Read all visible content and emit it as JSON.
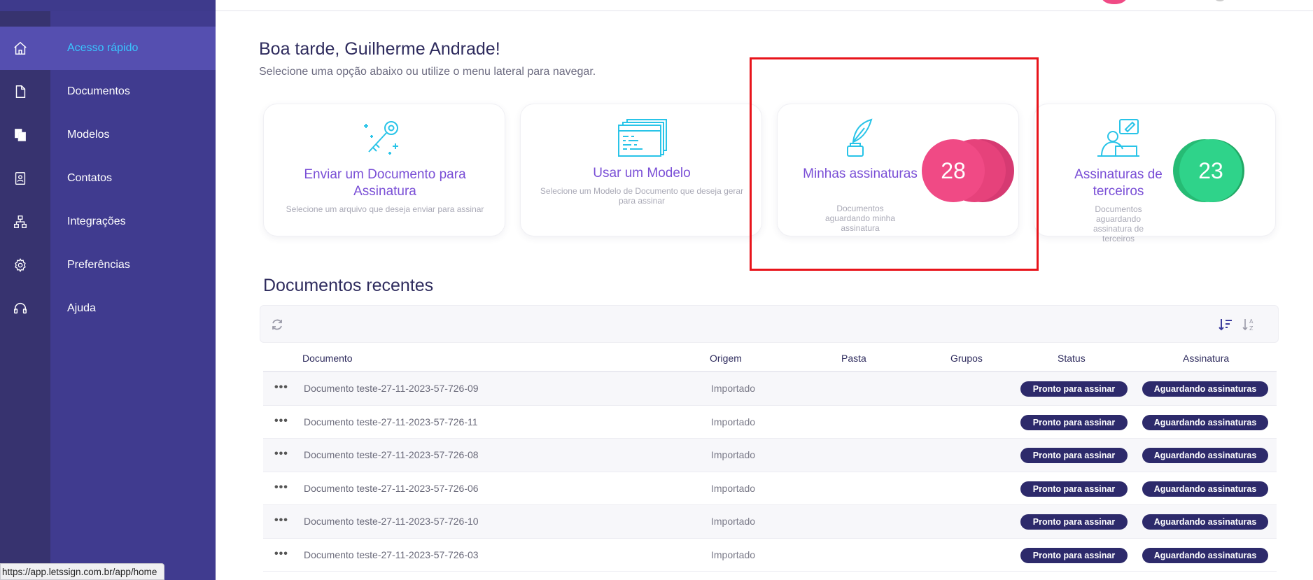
{
  "sidebar": {
    "items": [
      {
        "label": "Acesso rápido",
        "icon": "home-icon"
      },
      {
        "label": "Documentos",
        "icon": "document-icon"
      },
      {
        "label": "Modelos",
        "icon": "templates-icon"
      },
      {
        "label": "Contatos",
        "icon": "contacts-icon"
      },
      {
        "label": "Integrações",
        "icon": "integrations-icon"
      },
      {
        "label": "Preferências",
        "icon": "gear-icon"
      },
      {
        "label": "Ajuda",
        "icon": "headset-icon"
      }
    ],
    "active_index": 0
  },
  "header": {
    "greeting": "Boa tarde, Guilherme Andrade!",
    "subtitle": "Selecione uma opção abaixo ou utilize o menu lateral para navegar."
  },
  "cards": [
    {
      "title": "Enviar um Documento para Assinatura",
      "description": "Selecione um arquivo que deseja enviar para assinar",
      "icon": "key-icon"
    },
    {
      "title": "Usar um Modelo",
      "description": "Selecione um Modelo de Documento que deseja gerar para assinar",
      "icon": "template-stack-icon"
    },
    {
      "title": "Minhas assinaturas",
      "description": "Documentos aguardando minha assinatura",
      "icon": "quill-icon",
      "count": "28"
    },
    {
      "title": "Assinaturas de terceiros",
      "description": "Documentos aguardando assinatura de terceiros",
      "icon": "person-signing-icon",
      "count": "23"
    }
  ],
  "recent": {
    "title": "Documentos recentes",
    "columns": [
      "Documento",
      "Origem",
      "Pasta",
      "Grupos",
      "Status",
      "Assinatura"
    ],
    "rows": [
      {
        "document": "Documento teste-27-11-2023-57-726-09",
        "origin": "Importado",
        "status": "Pronto para assinar",
        "signature": "Aguardando assinaturas"
      },
      {
        "document": "Documento teste-27-11-2023-57-726-11",
        "origin": "Importado",
        "status": "Pronto para assinar",
        "signature": "Aguardando assinaturas"
      },
      {
        "document": "Documento teste-27-11-2023-57-726-08",
        "origin": "Importado",
        "status": "Pronto para assinar",
        "signature": "Aguardando assinaturas"
      },
      {
        "document": "Documento teste-27-11-2023-57-726-06",
        "origin": "Importado",
        "status": "Pronto para assinar",
        "signature": "Aguardando assinaturas"
      },
      {
        "document": "Documento teste-27-11-2023-57-726-10",
        "origin": "Importado",
        "status": "Pronto para assinar",
        "signature": "Aguardando assinaturas"
      },
      {
        "document": "Documento teste-27-11-2023-57-726-03",
        "origin": "Importado",
        "status": "Pronto para assinar",
        "signature": "Aguardando assinaturas"
      }
    ],
    "row_menu_label": "•••"
  },
  "statusbar": {
    "url": "https://app.letssign.com.br/app/home"
  },
  "colors": {
    "sidebar": "#403b8f",
    "sidebar_active": "#554fb0",
    "accent_purple": "#7a4fd6",
    "icon_cyan": "#29c4e8",
    "badge_pink": "#f04a85",
    "badge_green": "#2fd38a",
    "pill_navy": "#2d2a6b",
    "highlight_red": "#e8141b"
  }
}
